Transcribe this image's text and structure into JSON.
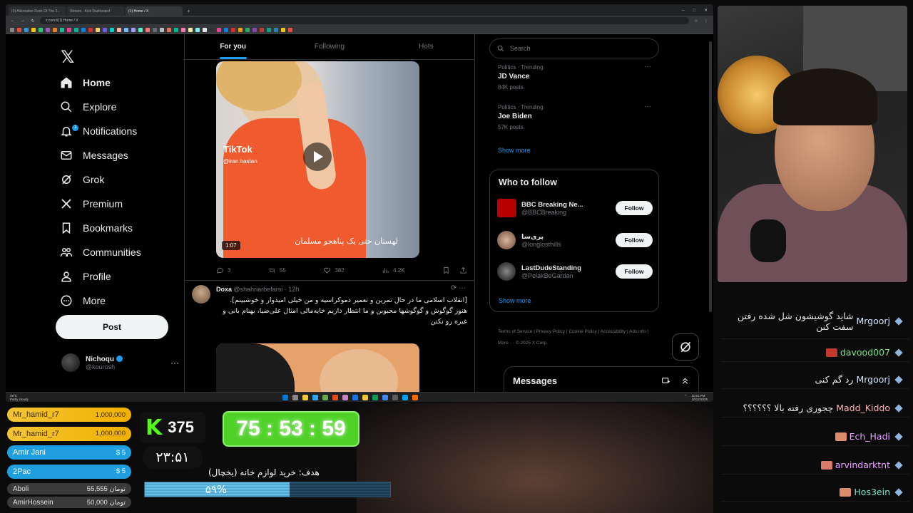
{
  "browser": {
    "tabs": [
      {
        "label": "(3) Alternative Rock Of The 2...",
        "active": false
      },
      {
        "label": "Stream - Kick Dashboard",
        "active": false
      },
      {
        "label": "(1) Home / X",
        "active": true
      }
    ],
    "url": "x.com/i/(1) Home / X"
  },
  "x": {
    "nav": [
      {
        "label": "Home",
        "icon": "home-icon"
      },
      {
        "label": "Explore",
        "icon": "search-icon"
      },
      {
        "label": "Notifications",
        "icon": "bell-icon",
        "badge": "1"
      },
      {
        "label": "Messages",
        "icon": "envelope-icon"
      },
      {
        "label": "Grok",
        "icon": "grok-icon"
      },
      {
        "label": "Premium",
        "icon": "x-icon"
      },
      {
        "label": "Bookmarks",
        "icon": "bookmark-icon"
      },
      {
        "label": "Communities",
        "icon": "people-icon"
      },
      {
        "label": "Profile",
        "icon": "person-icon"
      },
      {
        "label": "More",
        "icon": "more-circle-icon"
      }
    ],
    "post_button": "Post",
    "account": {
      "name": "Nichoqu",
      "handle": "@kourosh"
    },
    "feed_tabs": [
      "For you",
      "Following",
      "Hots"
    ],
    "video": {
      "brand": "TikTok",
      "handle": "@iran.bastan",
      "caption": "لهستان حتی یک پناهجو مسلمان",
      "duration": "1:07"
    },
    "actions": {
      "replies": "3",
      "reposts": "55",
      "likes": "382",
      "views": "4.2K"
    },
    "tweet2": {
      "name": "Doxa",
      "handle": "@shahriarbefarsi",
      "time": "12h",
      "line1": "[انقلاب اسلامی ما در حال تمرین و تعمیر دموکراسیه و من خیلی امیدوار و خوشبینم].",
      "line2": "هنوز گوگوش و گوگوشها محبوبن و ما انتظار داریم خایه‌مالی امثال علی‌ضیا، بهنام بانی و",
      "line3": "غیره رو نکنن"
    },
    "search_placeholder": "Search",
    "trends": [
      {
        "meta": "Politics · Trending",
        "name": "JD Vance",
        "count": "84K posts"
      },
      {
        "meta": "Politics · Trending",
        "name": "Joe Biden",
        "count": "57K posts"
      }
    ],
    "show_more": "Show more",
    "who_to_follow": "Who to follow",
    "follow_suggestions": [
      {
        "name": "BBC Breaking Ne...",
        "handle": "@BBCBreaking",
        "btn": "Follow"
      },
      {
        "name": "پری‌سا",
        "handle": "@longlosthills",
        "btn": "Follow"
      },
      {
        "name": "LastDudeStanding",
        "handle": "@PelakBeGardan",
        "btn": "Follow"
      }
    ],
    "footer": "Terms of Service  |  Privacy Policy  |  Cookie Policy  |  Accessibility  |  Ads info  |  More ···  © 2025 X Corp.",
    "messages": "Messages"
  },
  "taskbar": {
    "weather_temp": "29°C",
    "weather_desc": "Partly cloudy",
    "time": "11:51 PM",
    "date": "10/12/2025"
  },
  "chat": [
    {
      "user": "Mrgoorj",
      "text": "شاید گوشیشون شل شده رفتن سفت کنن",
      "color": "#cfe3ff"
    },
    {
      "user": "davood007",
      "text": "",
      "color": "#7de38a",
      "emote": "#c0392b"
    },
    {
      "user": "Mrgoorj",
      "text": "رد گم کنی",
      "color": "#cfe3ff"
    },
    {
      "user": "Madd_Kiddo",
      "text": "چجوری رفته بالا ؟؟؟؟؟؟",
      "color": "#f7b3b3"
    },
    {
      "user": "Ech_Hadi",
      "text": "",
      "color": "#e8a2ff",
      "emote": "#d98b6a"
    },
    {
      "user": "arvindarktnt",
      "text": "",
      "color": "#e8a2ff",
      "emote": "#d97a6a"
    },
    {
      "user": "Hos3ein",
      "text": "",
      "color": "#7de3c9",
      "emote": "#d98b6a"
    }
  ],
  "leaderboard": [
    {
      "user": "Mr_hamid_r7",
      "amount": "1,000,000",
      "style": "gold"
    },
    {
      "user": "Mr_hamid_r7",
      "amount": "1,000,000",
      "style": "gold"
    },
    {
      "user": "Amir Jani",
      "amount": "$ 5",
      "style": "blue"
    },
    {
      "user": "2Pac",
      "amount": "$ 5",
      "style": "blue"
    },
    {
      "user": "Aboli",
      "amount": "55,555 تومان",
      "style": "dark"
    },
    {
      "user": "AmirHossein",
      "amount": "50,000 تومان",
      "style": "dark"
    }
  ],
  "kick_viewers": "375",
  "countdown": "75 : 53 : 59",
  "clock": "۲۳:۵۱",
  "goal": {
    "label": "هدف: خرید لوازم خانه (یخچال)",
    "percent_text": "۵۹%",
    "percent": 0.59
  },
  "colors": {
    "x_blue": "#1d9bf0",
    "kick_green": "#53fc18",
    "timer_green": "#4fd128"
  }
}
